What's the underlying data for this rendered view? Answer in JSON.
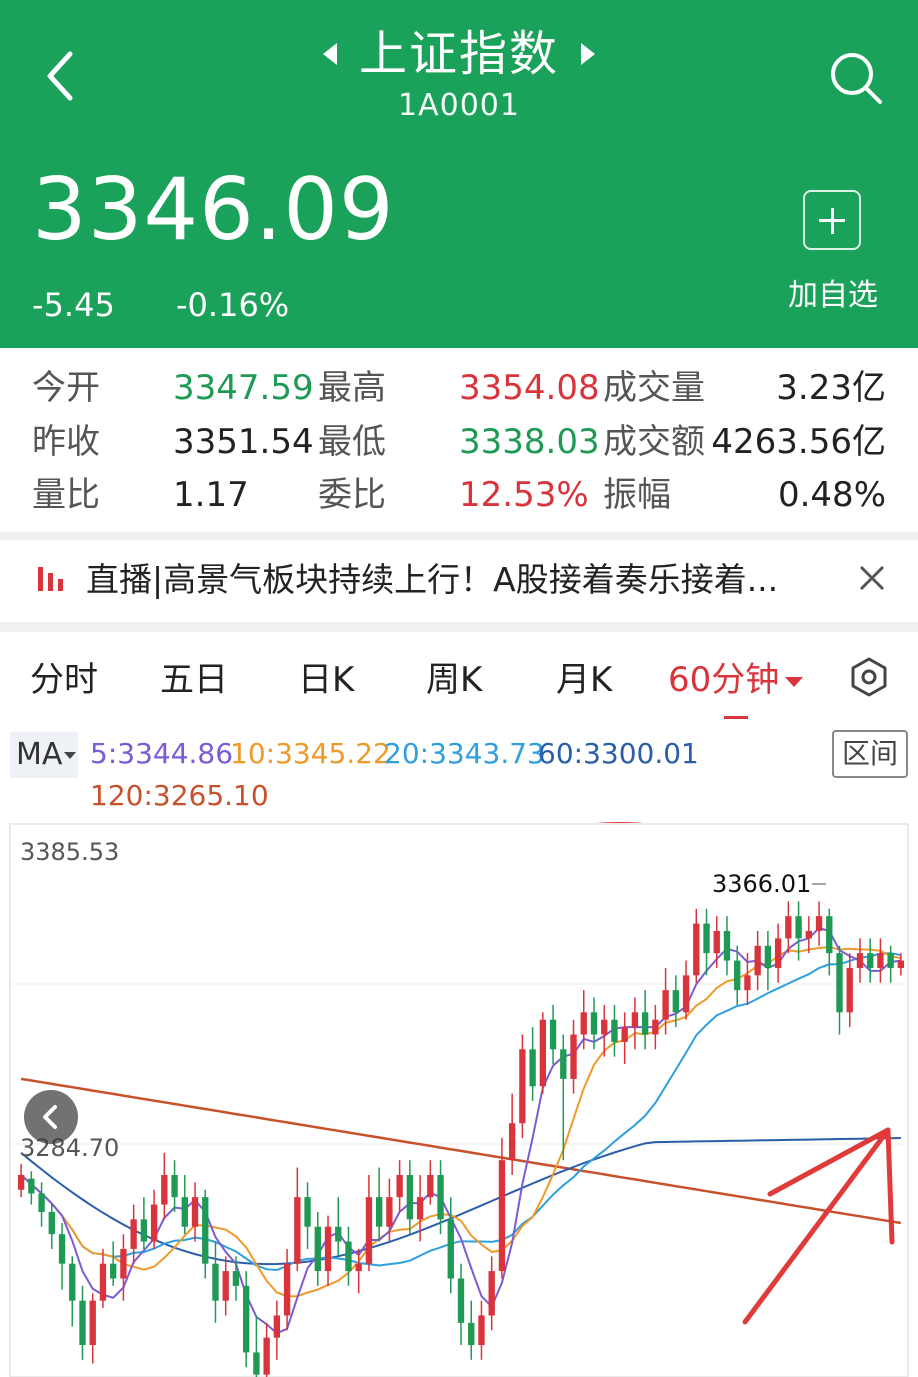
{
  "header": {
    "title": "上证指数",
    "code": "1A0001",
    "price": "3346.09",
    "change_abs": "-5.45",
    "change_pct": "-0.16%",
    "add_label": "加自选",
    "icons": {
      "back": "chevron-left-icon",
      "prev": "triangle-left-icon",
      "next": "triangle-right-icon",
      "search": "search-icon",
      "add": "plus-icon"
    },
    "color": "#1aa15a"
  },
  "stats": {
    "rows": [
      {
        "l1": "今开",
        "v1": "3347.59",
        "l2": "最高",
        "v2": "3354.08",
        "l3": "成交量",
        "v3": "3.23亿"
      },
      {
        "l1": "昨收",
        "v1": "3351.54",
        "l2": "最低",
        "v2": "3338.03",
        "l3": "成交额",
        "v3": "4263.56亿"
      },
      {
        "l1": "量比",
        "v1": "1.17",
        "l2": "委比",
        "v2": "12.53%",
        "l3": "振幅",
        "v3": "0.48%"
      }
    ],
    "colors": {
      "up": "#d9343c",
      "down": "#1e9a55"
    }
  },
  "news": {
    "text": "直播|高景气板块持续上行！A股接着奏乐接着...",
    "icon": "live-bars-icon",
    "close_icon": "close-icon"
  },
  "tabs": {
    "items": [
      "分时",
      "五日",
      "日K",
      "周K",
      "月K",
      "60分钟"
    ],
    "active": "60分钟",
    "settings_icon": "settings-icon"
  },
  "ma": {
    "toggle_label": "MA",
    "ma5": "5:3344.86",
    "ma10": "10:3345.22",
    "ma20": "20:3343.73",
    "ma60": "60:3300.01",
    "ma120": "120:3265.10",
    "range_label": "区间",
    "colors": {
      "ma5": "#7b5bd6",
      "ma10": "#f09a2a",
      "ma20": "#2f9fe0",
      "ma60": "#2a5ea8",
      "ma120": "#c8502a"
    }
  },
  "chart_data": {
    "type": "candlestick",
    "axis_top_label": "3385.53",
    "axis_mid_label": "3284.70",
    "high_label": "3366.01",
    "ylim": [
      3240,
      3385.53
    ],
    "candles": [
      [
        3292,
        3296,
        3299,
        3290
      ],
      [
        3295,
        3291,
        3297,
        3288
      ],
      [
        3291,
        3286,
        3294,
        3282
      ],
      [
        3286,
        3280,
        3288,
        3276
      ],
      [
        3280,
        3272,
        3283,
        3265
      ],
      [
        3272,
        3262,
        3274,
        3255
      ],
      [
        3262,
        3250,
        3266,
        3246
      ],
      [
        3250,
        3262,
        3264,
        3245
      ],
      [
        3262,
        3272,
        3276,
        3260
      ],
      [
        3272,
        3268,
        3278,
        3266
      ],
      [
        3268,
        3276,
        3280,
        3262
      ],
      [
        3276,
        3284,
        3288,
        3272
      ],
      [
        3284,
        3278,
        3290,
        3276
      ],
      [
        3278,
        3288,
        3292,
        3276
      ],
      [
        3288,
        3296,
        3302,
        3284
      ],
      [
        3296,
        3290,
        3300,
        3286
      ],
      [
        3290,
        3282,
        3296,
        3280
      ],
      [
        3282,
        3290,
        3294,
        3278
      ],
      [
        3290,
        3272,
        3292,
        3268
      ],
      [
        3272,
        3262,
        3278,
        3256
      ],
      [
        3262,
        3270,
        3274,
        3258
      ],
      [
        3270,
        3266,
        3274,
        3262
      ],
      [
        3266,
        3248,
        3270,
        3244
      ],
      [
        3248,
        3242,
        3258,
        3240
      ],
      [
        3242,
        3252,
        3256,
        3238
      ],
      [
        3252,
        3258,
        3262,
        3246
      ],
      [
        3258,
        3272,
        3276,
        3254
      ],
      [
        3272,
        3290,
        3298,
        3270
      ],
      [
        3290,
        3282,
        3294,
        3276
      ],
      [
        3282,
        3270,
        3286,
        3266
      ],
      [
        3270,
        3282,
        3285,
        3266
      ],
      [
        3282,
        3278,
        3290,
        3274
      ],
      [
        3278,
        3270,
        3282,
        3266
      ],
      [
        3270,
        3272,
        3276,
        3264
      ],
      [
        3272,
        3290,
        3296,
        3270
      ],
      [
        3290,
        3282,
        3298,
        3278
      ],
      [
        3282,
        3290,
        3295,
        3278
      ],
      [
        3290,
        3296,
        3300,
        3286
      ],
      [
        3296,
        3284,
        3300,
        3280
      ],
      [
        3284,
        3290,
        3296,
        3278
      ],
      [
        3290,
        3296,
        3300,
        3288
      ],
      [
        3296,
        3284,
        3300,
        3280
      ],
      [
        3284,
        3268,
        3290,
        3264
      ],
      [
        3268,
        3256,
        3272,
        3250
      ],
      [
        3256,
        3250,
        3262,
        3246
      ],
      [
        3250,
        3258,
        3262,
        3246
      ],
      [
        3258,
        3270,
        3274,
        3254
      ],
      [
        3270,
        3300,
        3306,
        3268
      ],
      [
        3300,
        3310,
        3318,
        3296
      ],
      [
        3310,
        3330,
        3334,
        3306
      ],
      [
        3330,
        3320,
        3336,
        3316
      ],
      [
        3320,
        3338,
        3340,
        3318
      ],
      [
        3338,
        3330,
        3342,
        3326
      ],
      [
        3330,
        3322,
        3334,
        3300
      ],
      [
        3322,
        3334,
        3338,
        3318
      ],
      [
        3334,
        3340,
        3346,
        3330
      ],
      [
        3340,
        3334,
        3344,
        3330
      ],
      [
        3334,
        3338,
        3342,
        3328
      ],
      [
        3338,
        3332,
        3342,
        3328
      ],
      [
        3332,
        3336,
        3340,
        3326
      ],
      [
        3336,
        3340,
        3344,
        3330
      ],
      [
        3340,
        3334,
        3346,
        3330
      ],
      [
        3334,
        3338,
        3342,
        3330
      ],
      [
        3338,
        3346,
        3352,
        3334
      ],
      [
        3346,
        3340,
        3350,
        3336
      ],
      [
        3340,
        3350,
        3354,
        3338
      ],
      [
        3350,
        3364,
        3368,
        3348
      ],
      [
        3364,
        3356,
        3368,
        3350
      ],
      [
        3356,
        3362,
        3366,
        3352
      ],
      [
        3362,
        3354,
        3366,
        3350
      ],
      [
        3354,
        3346,
        3358,
        3342
      ],
      [
        3346,
        3350,
        3356,
        3342
      ],
      [
        3350,
        3358,
        3362,
        3346
      ],
      [
        3358,
        3352,
        3362,
        3346
      ],
      [
        3352,
        3360,
        3364,
        3348
      ],
      [
        3360,
        3366,
        3370,
        3356
      ],
      [
        3366,
        3360,
        3370,
        3354
      ],
      [
        3360,
        3362,
        3366,
        3356
      ],
      [
        3362,
        3366.01,
        3370,
        3358
      ],
      [
        3366,
        3356,
        3368,
        3350
      ],
      [
        3356,
        3340,
        3358,
        3334
      ],
      [
        3340,
        3352,
        3356,
        3336
      ],
      [
        3352,
        3356,
        3360,
        3348
      ],
      [
        3356,
        3352,
        3360,
        3348
      ],
      [
        3352,
        3356,
        3360,
        3348
      ],
      [
        3356,
        3352,
        3358,
        3348
      ],
      [
        3352,
        3354,
        3356,
        3350
      ]
    ],
    "ma120_start": 3322,
    "ma120_end": 3283,
    "ma60_start": 3302,
    "ma60_end": 3306
  }
}
